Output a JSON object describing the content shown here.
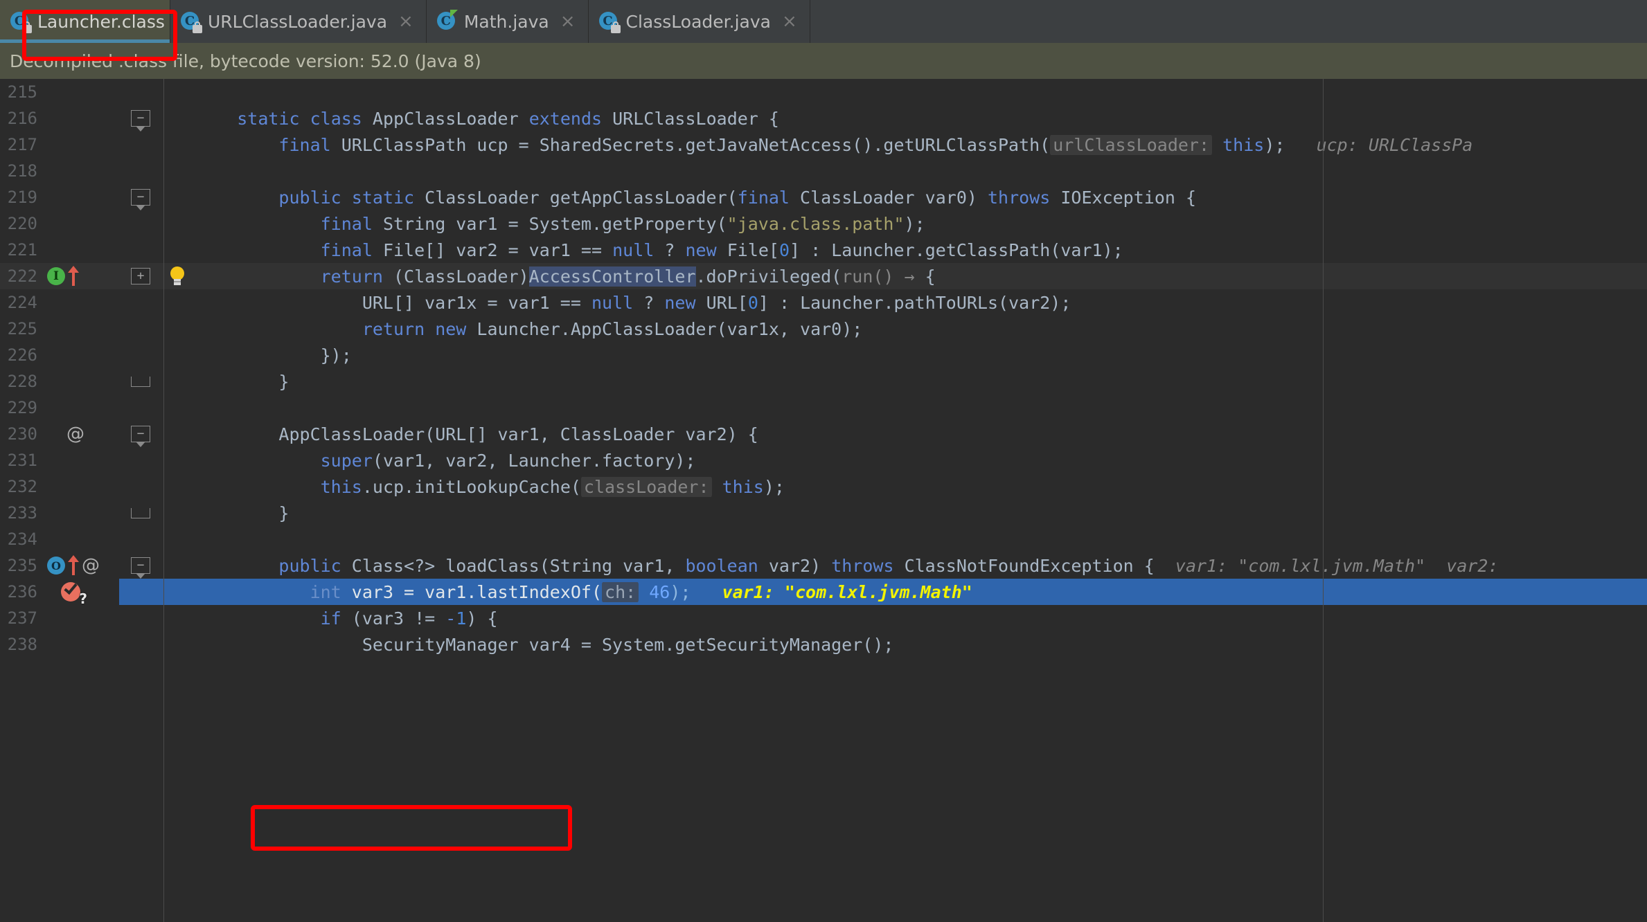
{
  "tabs": [
    {
      "label": "Launcher.class",
      "icon": "java-class-locked-icon",
      "active": true,
      "close": "×"
    },
    {
      "label": "URLClassLoader.java",
      "icon": "java-class-locked-icon",
      "active": false,
      "close": "×"
    },
    {
      "label": "Math.java",
      "icon": "java-class-icon",
      "active": false,
      "close": "×"
    },
    {
      "label": "ClassLoader.java",
      "icon": "java-class-locked-icon",
      "active": false,
      "close": "×"
    }
  ],
  "banner": {
    "text": "Decompiled .class file, bytecode version: 52.0 (Java 8)"
  },
  "colors": {
    "accent_tab_underline": "#4a88a8",
    "banner_background": "#4e5142",
    "editor_background": "#2b2b2b",
    "execution_line": "#2f65ad",
    "annotation_red": "#ff0000",
    "keyword_orange": "#cc7832",
    "keyword_blue": "#5f87d7",
    "string_olive": "#a5a06a",
    "number_blue": "#4a86d8",
    "identifier": "#a9b7c6",
    "inlay_hint_gray": "#868686",
    "debug_hint_yellow": "#f3f300"
  },
  "lines": {
    "l215": {
      "number": "215"
    },
    "l216": {
      "number": "216"
    },
    "l217": {
      "number": "217",
      "hint": "ucp: URLClassPa"
    },
    "l218": {
      "number": "218"
    },
    "l219": {
      "number": "219"
    },
    "l220": {
      "number": "220"
    },
    "l221": {
      "number": "221"
    },
    "l222": {
      "number": "222"
    },
    "l224": {
      "number": "224"
    },
    "l225": {
      "number": "225"
    },
    "l226": {
      "number": "226"
    },
    "l228": {
      "number": "228"
    },
    "l229": {
      "number": "229"
    },
    "l230": {
      "number": "230"
    },
    "l231": {
      "number": "231"
    },
    "l232": {
      "number": "232"
    },
    "l233": {
      "number": "233"
    },
    "l234": {
      "number": "234"
    },
    "l235": {
      "number": "235",
      "hint1": "var1: \"com.lxl.jvm.Math\"",
      "hint2": "var2:"
    },
    "l236": {
      "number": "236",
      "hint": "var1: \"com.lxl.jvm.Math\""
    },
    "l237": {
      "number": "237"
    },
    "l238": {
      "number": "238"
    }
  },
  "code": {
    "t216_static": "static",
    "t216_class": "class",
    "t216_name": "AppClassLoader",
    "t216_extends": "extends",
    "t216_super": "URLClassLoader {",
    "t217_final": "final",
    "t217_rest": "URLClassPath ucp = SharedSecrets.getJavaNetAccess().getURLClassPath(",
    "t217_inlay": "urlClassLoader:",
    "t217_this": "this",
    "t217_tail": ");",
    "t219_public": "public",
    "t219_static": "static",
    "t219_sig": "ClassLoader getAppClassLoader(",
    "t219_final": "final",
    "t219_args": "ClassLoader var0)",
    "t219_throws": "throws",
    "t219_tail": "IOException {",
    "t220_final": "final",
    "t220_mid": "String var1 = System.getProperty(",
    "t220_str": "\"java.class.path\"",
    "t220_tail": ");",
    "t221_final": "final",
    "t221_a": "File[] var2 = var1 ==",
    "t221_null": "null",
    "t221_q": "?",
    "t221_new": "new",
    "t221_file": "File[",
    "t221_zero": "0",
    "t221_b": "] : Launcher.getClassPath(var1);",
    "t222_return": "return",
    "t222_cast": "(ClassLoader)",
    "t222_sel": "AccessController",
    "t222_mid": ".doPrivileged(",
    "t222_run": "run()",
    "t222_arrow": "→",
    "t222_tail": "{",
    "t224_a": "URL[] var1x = var1 ==",
    "t224_null": "null",
    "t224_q": "?",
    "t224_new": "new",
    "t224_url": "URL[",
    "t224_zero": "0",
    "t224_b": "] : Launcher.pathToURLs(var2);",
    "t225_return": "return",
    "t225_new": "new",
    "t225_rest": "Launcher.AppClassLoader(var1x, var0);",
    "t226": "});",
    "t228": "}",
    "t230": "AppClassLoader(URL[] var1, ClassLoader var2) {",
    "t231_super": "super",
    "t231_rest": "(var1, var2, Launcher.factory);",
    "t232_this": "this",
    "t232_mid": ".ucp.initLookupCache(",
    "t232_inlay": "classLoader:",
    "t232_this2": "this",
    "t232_tail": ");",
    "t233": "}",
    "t235_public": "public",
    "t235_sig": "Class<?> loadClass(String var1,",
    "t235_bool": "boolean",
    "t235_var2": "var2)",
    "t235_throws": "throws",
    "t235_tail": "ClassNotFoundException {",
    "t236_int": "int",
    "t236_mid": "var3 = var1.lastIndexOf(",
    "t236_inlay": "ch:",
    "t236_num": "46",
    "t236_tail": ");",
    "t237_if": "if",
    "t237_a": "(var3 !=",
    "t237_minus": "-",
    "t237_one": "1",
    "t237_b": ") {",
    "t238": "SecurityManager var4 = System.getSecurityManager();"
  },
  "gutter_markers": {
    "l222_impl": "I",
    "l230_annotation": "@",
    "l235_override": "O",
    "l235_annotation": "@"
  }
}
